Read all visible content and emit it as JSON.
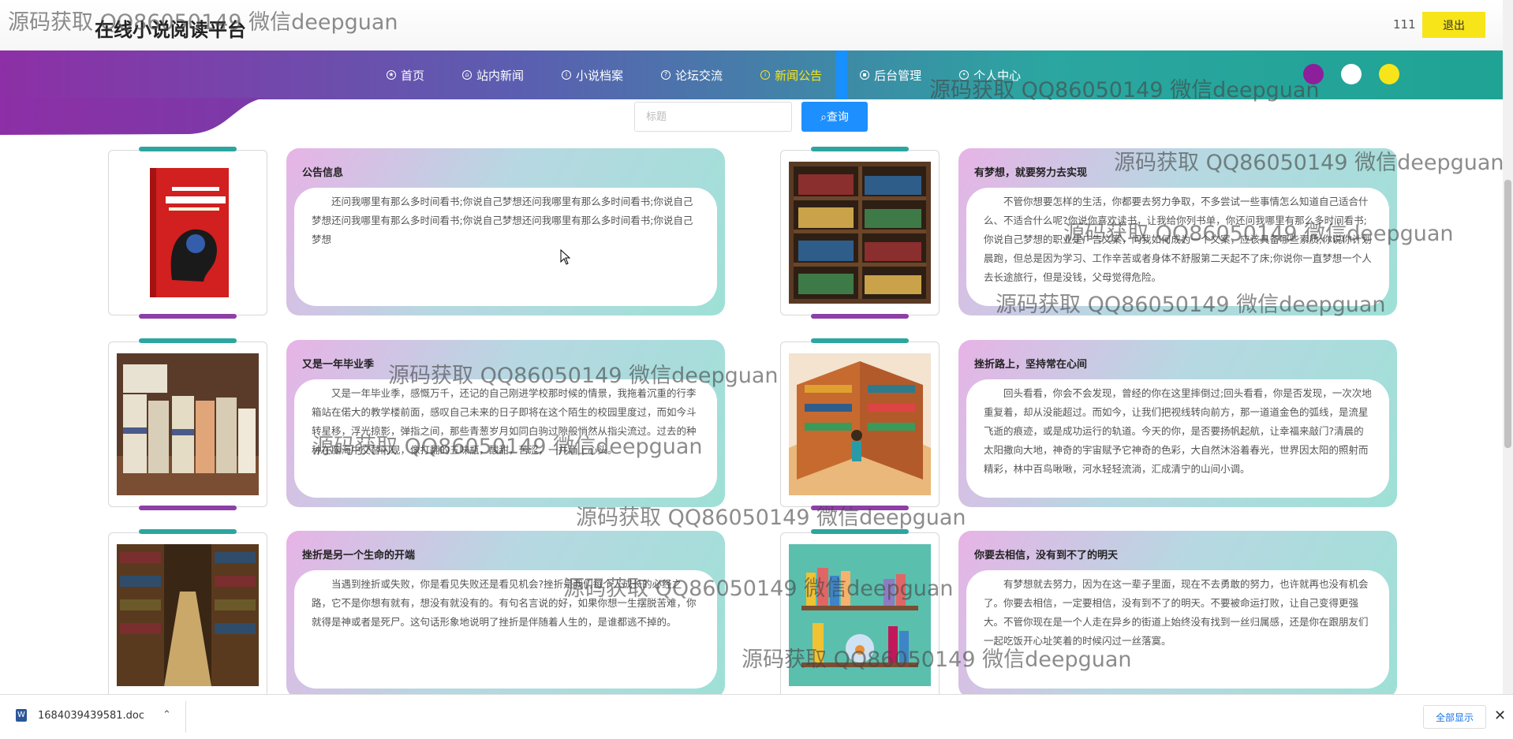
{
  "header": {
    "site_title": "在线小说阅读平台",
    "user_name": "111",
    "logout_label": "退出"
  },
  "nav": {
    "items": [
      {
        "label": "首页",
        "icon": "star-icon"
      },
      {
        "label": "站内新闻",
        "icon": "home-icon"
      },
      {
        "label": "小说档案",
        "icon": "info-icon"
      },
      {
        "label": "论坛交流",
        "icon": "question-icon"
      },
      {
        "label": "新闻公告",
        "icon": "info-icon",
        "active": true
      },
      {
        "label": "后台管理",
        "icon": "lock-icon"
      },
      {
        "label": "个人中心",
        "icon": "user-icon"
      }
    ],
    "theme_dots": [
      "#8d1f9a",
      "#ffffff",
      "#f7e51a"
    ],
    "accent": "#f7e51a"
  },
  "search": {
    "placeholder": "标题",
    "button_label": "查询"
  },
  "articles": [
    {
      "title": "公告信息",
      "body": "还问我哪里有那么多时间看书;你说自己梦想还问我哪里有那么多时间看书;你说自己梦想还问我哪里有那么多时间看书;你说自己梦想还问我哪里有那么多时间看书;你说自己梦想",
      "image": "memory-book-cover"
    },
    {
      "title": "有梦想，就要努力去实现",
      "body": "不管你想要怎样的生活，你都要去努力争取，不多尝试一些事情怎么知道自己适合什么、不适合什么呢?你说你喜欢读书，让我给你列书单，你还问我哪里有那么多时间看书;你说自己梦想的职业是广告文案，问我如何成为一个文案，应该具备哪些素质;你说你计划晨跑，但总是因为学习、工作辛苦或者身体不舒服第二天起不了床;你说你一直梦想一个人去长途旅行，但是没钱，父母觉得危险。",
      "image": "bookshelf"
    },
    {
      "title": "又是一年毕业季",
      "body": "又是一年毕业季，感慨万千，还记的自己刚进学校那时候的情景，我拖着沉重的行李箱站在偌大的教学楼前面，感叹自己未来的日子即将在这个陌生的校园里度过，而如今斗转星移，浮光掠影，弹指之间，那些青葱岁月如同白驹过隙般悄然从指尖流过。过去的种种在脑海中交替闪现，像打翻的五味瓶，酸甜，苦涩，一并涌上心头。",
      "image": "book-boxes"
    },
    {
      "title": "挫折路上，坚持常在心间",
      "body": "回头看看，你会不会发现，曾经的你在这里摔倒过;回头看看，你是否发现，一次次地重复着，却从没能超过。而如今，让我们把视线转向前方，那一道道金色的弧线，是流星飞逝的痕迹，或是成功运行的轨道。今天的你，是否要扬帆起航，让幸福来敲门?清晨的太阳撒向大地，神奇的宇宙赋予它神奇的色彩，大自然沐浴着春光，世界因太阳的照射而精彩，林中百鸟啾啾，河水轻轻流淌，汇成清宁的山间小调。",
      "image": "library-illustration"
    },
    {
      "title": "挫折是另一个生命的开端",
      "body": "当遇到挫折或失败，你是看见失败还是看见机会?挫折是我们每个人成长的必经之路，它不是你想有就有，想没有就没有的。有句名言说的好，如果你想一生摆脱苦难，你就得是神或者是死尸。这句话形象地说明了挫折是伴随着人生的，是谁都逃不掉的。",
      "image": "library-aisle"
    },
    {
      "title": "你要去相信，没有到不了的明天",
      "body": "有梦想就去努力，因为在这一辈子里面，现在不去勇敢的努力，也许就再也没有机会了。你要去相信，一定要相信，没有到不了的明天。不要被命运打败，让自己变得更强大。不管你现在是一个人走在异乡的街道上始终没有找到一丝归属感，还是你在跟朋友们一起吃饭开心址笑着的时候闪过一丝落寞。",
      "image": "shelf-illustration"
    }
  ],
  "watermark": "源码获取 QQ86050149 微信deepguan",
  "download_bar": {
    "file_name": "1684039439581.doc",
    "show_all_label": "全部显示"
  }
}
